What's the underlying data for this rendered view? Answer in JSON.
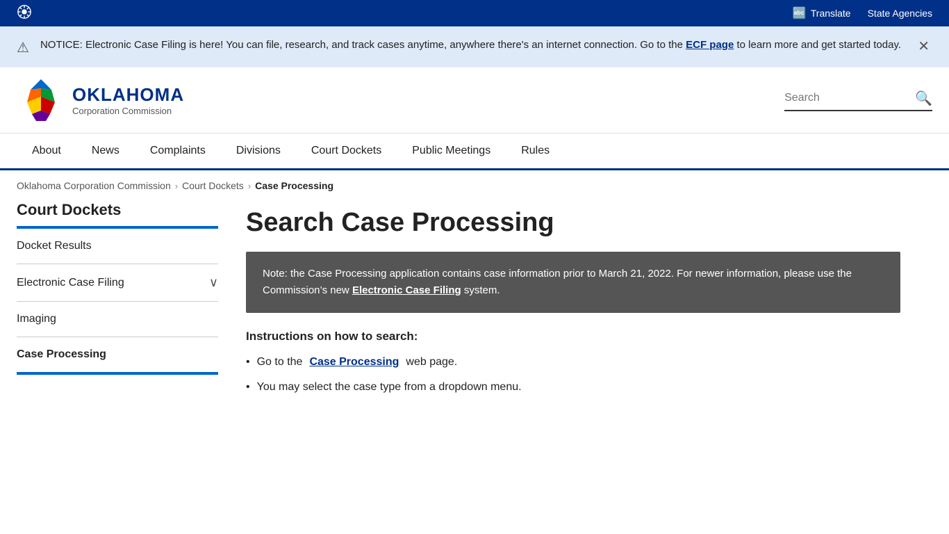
{
  "topbar": {
    "logo_alt": "Oklahoma state logo",
    "translate_label": "Translate",
    "state_agencies_label": "State Agencies"
  },
  "notice": {
    "text_before_link": "NOTICE: Electronic Case Filing is here! You can file, research, and track cases anytime, anywhere there's an internet connection. Go to the ",
    "link_text": "ECF page",
    "text_after_link": " to learn more and get started today."
  },
  "header": {
    "logo_oklahoma": "OKLAHOMA",
    "logo_sub": "Corporation Commission",
    "search_placeholder": "Search",
    "search_button_label": "Search"
  },
  "nav": {
    "items": [
      {
        "label": "About",
        "href": "#"
      },
      {
        "label": "News",
        "href": "#"
      },
      {
        "label": "Complaints",
        "href": "#"
      },
      {
        "label": "Divisions",
        "href": "#"
      },
      {
        "label": "Court Dockets",
        "href": "#"
      },
      {
        "label": "Public Meetings",
        "href": "#"
      },
      {
        "label": "Rules",
        "href": "#"
      }
    ]
  },
  "breadcrumb": {
    "items": [
      {
        "label": "Oklahoma Corporation Commission",
        "href": "#"
      },
      {
        "label": "Court Dockets",
        "href": "#"
      },
      {
        "label": "Case Processing",
        "current": true
      }
    ]
  },
  "sidebar": {
    "title": "Court Dockets",
    "items": [
      {
        "label": "Docket Results",
        "active": false,
        "expandable": false
      },
      {
        "label": "Electronic Case Filing",
        "active": false,
        "expandable": true
      },
      {
        "label": "Imaging",
        "active": false,
        "expandable": false
      },
      {
        "label": "Case Processing",
        "active": true,
        "expandable": false
      }
    ]
  },
  "content": {
    "page_title": "Search Case Processing",
    "info_box": {
      "text_before": "Note: the Case Processing application contains case information prior to March 21, 2022. For newer information, please use the Commission’s new ",
      "link_text": "Electronic Case Filing",
      "text_after": " system."
    },
    "instructions_title": "Instructions on how to search:",
    "instructions": [
      {
        "text_before": "Go to the ",
        "link_text": "Case Processing",
        "text_after": " web page."
      },
      {
        "text": "You may select the case type from a dropdown menu."
      }
    ]
  }
}
